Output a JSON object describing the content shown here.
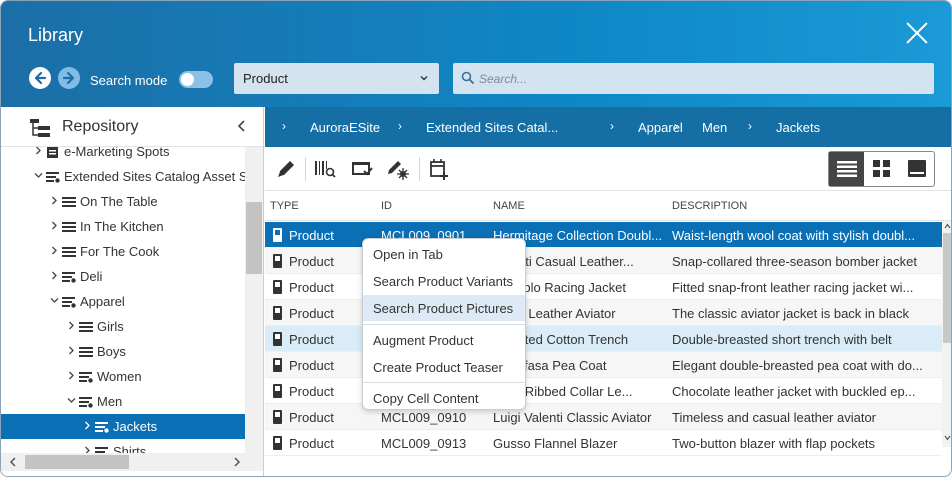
{
  "window": {
    "title": "Library"
  },
  "header": {
    "search_mode_label": "Search mode",
    "search_mode_on": false,
    "type_select_value": "Product",
    "search_placeholder": "Search..."
  },
  "left_panel": {
    "title": "Repository",
    "tree": [
      {
        "label": "e-Marketing Spots",
        "icon": "catalog-icon",
        "depth": 1,
        "expanded": false
      },
      {
        "label": "Extended Sites Catalog Asset S",
        "icon": "catalog-stack-icon",
        "depth": 1,
        "expanded": true
      },
      {
        "label": "On The Table",
        "icon": "list-icon",
        "depth": 2,
        "expanded": false
      },
      {
        "label": "In The Kitchen",
        "icon": "list-icon",
        "depth": 2,
        "expanded": false
      },
      {
        "label": "For The Cook",
        "icon": "list-icon",
        "depth": 2,
        "expanded": false
      },
      {
        "label": "Deli",
        "icon": "list-gear-icon",
        "depth": 2,
        "expanded": false
      },
      {
        "label": "Apparel",
        "icon": "list-gear-icon",
        "depth": 2,
        "expanded": true
      },
      {
        "label": "Girls",
        "icon": "list-icon",
        "depth": 3,
        "expanded": false
      },
      {
        "label": "Boys",
        "icon": "list-icon",
        "depth": 3,
        "expanded": false
      },
      {
        "label": "Women",
        "icon": "list-gear-icon",
        "depth": 3,
        "expanded": false
      },
      {
        "label": "Men",
        "icon": "list-gear-icon",
        "depth": 3,
        "expanded": true
      },
      {
        "label": "Jackets",
        "icon": "list-gear-icon",
        "depth": 4,
        "expanded": false,
        "selected": true
      },
      {
        "label": "Shirts",
        "icon": "list-gear-icon",
        "depth": 4,
        "expanded": false
      }
    ]
  },
  "breadcrumb": [
    "AuroraESite",
    "Extended Sites Catal...",
    "Apparel",
    "Men",
    "Jackets"
  ],
  "table": {
    "columns": [
      "TYPE",
      "ID",
      "NAME",
      "DESCRIPTION"
    ],
    "rows": [
      {
        "type": "Product",
        "id": "MCL009_0901",
        "name": "Hermitage Collection Doubl...",
        "description": "Waist-length wool coat with stylish doubl..."
      },
      {
        "type": "Product",
        "id": "",
        "name": "Valenti Casual Leather...",
        "description": "Snap-collared three-season bomber jacket"
      },
      {
        "type": "Product",
        "id": "",
        "name": "o Diablo Racing Jacket",
        "description": "Fitted snap-front leather racing jacket wi..."
      },
      {
        "type": "Product",
        "id": "",
        "name": "Black Leather Aviator",
        "description": "The classic aviator jacket is back in black"
      },
      {
        "type": "Product",
        "id": "",
        "name": "til Belted Cotton Trench",
        "description": "Double-breasted short trench with belt"
      },
      {
        "type": "Product",
        "id": "",
        "name": "til Mufasa Pea Coat",
        "description": "Elegant double-breasted pea coat with do..."
      },
      {
        "type": "Product",
        "id": "",
        "name": "itage Ribbed Collar Le...",
        "description": "Chocolate leather jacket with buckled ep..."
      },
      {
        "type": "Product",
        "id": "MCL009_0910",
        "name": "Luigi Valenti Classic Aviator",
        "description": "Timeless and casual leather aviator"
      },
      {
        "type": "Product",
        "id": "MCL009_0913",
        "name": "Gusso Flannel Blazer",
        "description": "Two-button blazer with flap pockets"
      }
    ]
  },
  "context_menu": {
    "items": [
      "Open in Tab",
      "Search Product Variants",
      "Search Product Pictures",
      "Augment Product",
      "Create Product Teaser",
      "Copy Cell Content"
    ]
  },
  "colors": {
    "header": "#0f87c6",
    "selection": "#0a6fb5",
    "breadcrumb_bar": "#156fa5"
  }
}
